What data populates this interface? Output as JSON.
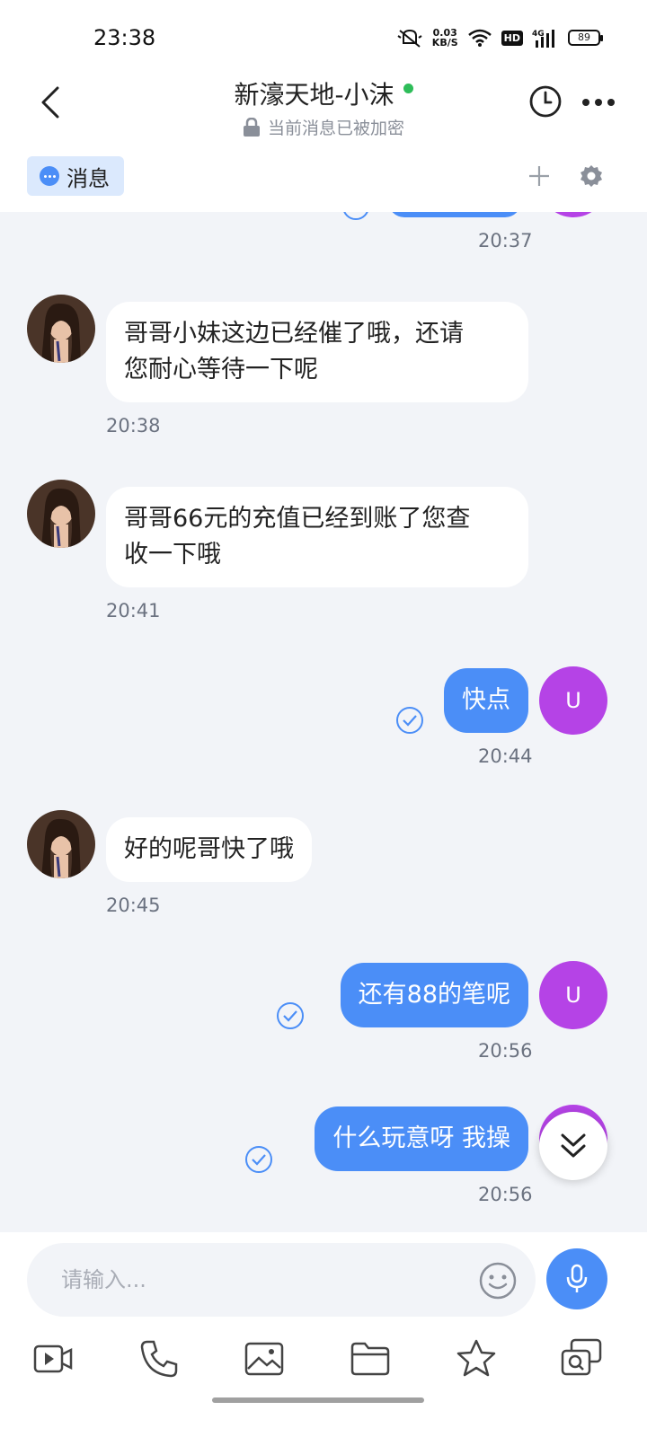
{
  "status_bar": {
    "time": "23:38",
    "speed": "0.03",
    "speed_unit": "KB/S",
    "hd": "HD",
    "network": "4G",
    "battery": "89"
  },
  "header": {
    "title": "新濠天地-小沫",
    "subtitle": "当前消息已被加密"
  },
  "tabs": {
    "messages_label": "消息"
  },
  "messages": [
    {
      "time": "20:37"
    },
    {
      "text_line1": "哥哥小妹这边已经催了哦，还请",
      "text_line2": "您耐心等待一下呢",
      "time": "20:38"
    },
    {
      "text_line1": "哥哥66元的充值已经到账了您查",
      "text_line2": "收一下哦",
      "time": "20:41"
    },
    {
      "text": "快点",
      "time": "20:44",
      "avatar_letter": "U"
    },
    {
      "text": "好的呢哥快了哦",
      "time": "20:45"
    },
    {
      "text": "还有88的笔呢",
      "time": "20:56",
      "avatar_letter": "U"
    },
    {
      "text": "什么玩意呀 我操",
      "time": "20:56"
    }
  ],
  "input": {
    "placeholder": "请输入..."
  },
  "colors": {
    "accent": "#4b8ef7",
    "user_avatar": "#b543e6",
    "online": "#2ebd59",
    "chat_bg": "#f2f4f8"
  },
  "icons": {
    "back": "back-icon",
    "history": "clock-icon",
    "more": "more-icon",
    "add": "plus-icon",
    "settings": "gear-icon",
    "emoji": "emoji-icon",
    "mic": "mic-icon",
    "scroll": "double-chevron-down-icon",
    "tools": [
      "video-icon",
      "phone-icon",
      "image-icon",
      "folder-icon",
      "star-icon",
      "quick-reply-icon"
    ]
  }
}
